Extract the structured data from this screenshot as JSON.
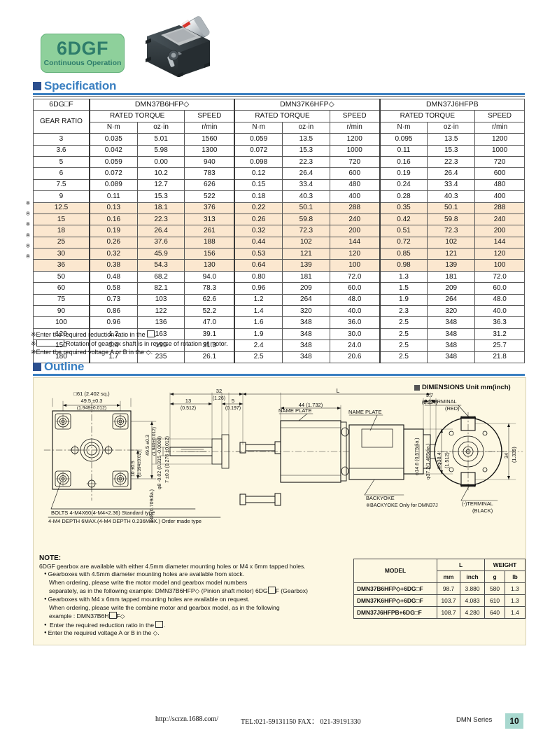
{
  "logo": {
    "model": "6DGF",
    "subtitle": "Continuous Operation"
  },
  "sections": {
    "specification": "Specification",
    "outline": "Outline"
  },
  "spec_table": {
    "corner_label": "6DG□F",
    "gear_ratio_label": "GEAR RATIO",
    "models": [
      "DMN37B6HFP◇",
      "DMN37K6HFP◇",
      "DMN37J6HFPB"
    ],
    "group_headers": [
      "RATED TORQUE",
      "SPEED"
    ],
    "units": [
      "N·m",
      "oz·in",
      "r/min"
    ],
    "rows": [
      {
        "ratio": "3",
        "mark": "",
        "hl": false,
        "v": [
          "0.035",
          "5.01",
          "1560",
          "0.059",
          "13.5",
          "1200",
          "0.095",
          "13.5",
          "1200"
        ]
      },
      {
        "ratio": "3.6",
        "mark": "",
        "hl": false,
        "v": [
          "0.042",
          "5.98",
          "1300",
          "0.072",
          "15.3",
          "1000",
          "0.11",
          "15.3",
          "1000"
        ]
      },
      {
        "ratio": "5",
        "mark": "",
        "hl": false,
        "v": [
          "0.059",
          "0.00",
          "940",
          "0.098",
          "22.3",
          "720",
          "0.16",
          "22.3",
          "720"
        ]
      },
      {
        "ratio": "6",
        "mark": "",
        "hl": false,
        "v": [
          "0.072",
          "10.2",
          "783",
          "0.12",
          "26.4",
          "600",
          "0.19",
          "26.4",
          "600"
        ]
      },
      {
        "ratio": "7.5",
        "mark": "",
        "hl": false,
        "v": [
          "0.089",
          "12.7",
          "626",
          "0.15",
          "33.4",
          "480",
          "0.24",
          "33.4",
          "480"
        ]
      },
      {
        "ratio": "9",
        "mark": "",
        "hl": false,
        "v": [
          "0.11",
          "15.3",
          "522",
          "0.18",
          "40.3",
          "400",
          "0.28",
          "40.3",
          "400"
        ]
      },
      {
        "ratio": "12.5",
        "mark": "※",
        "hl": true,
        "v": [
          "0.13",
          "18.1",
          "376",
          "0.22",
          "50.1",
          "288",
          "0.35",
          "50.1",
          "288"
        ]
      },
      {
        "ratio": "15",
        "mark": "※",
        "hl": true,
        "v": [
          "0.16",
          "22.3",
          "313",
          "0.26",
          "59.8",
          "240",
          "0.42",
          "59.8",
          "240"
        ]
      },
      {
        "ratio": "18",
        "mark": "※",
        "hl": true,
        "v": [
          "0.19",
          "26.4",
          "261",
          "0.32",
          "72.3",
          "200",
          "0.51",
          "72.3",
          "200"
        ]
      },
      {
        "ratio": "25",
        "mark": "※",
        "hl": true,
        "v": [
          "0.26",
          "37.6",
          "188",
          "0.44",
          "102",
          "144",
          "0.72",
          "102",
          "144"
        ]
      },
      {
        "ratio": "30",
        "mark": "※",
        "hl": true,
        "v": [
          "0.32",
          "45.9",
          "156",
          "0.53",
          "121",
          "120",
          "0.85",
          "121",
          "120"
        ]
      },
      {
        "ratio": "36",
        "mark": "※",
        "hl": true,
        "v": [
          "0.38",
          "54.3",
          "130",
          "0.64",
          "139",
          "100",
          "0.98",
          "139",
          "100"
        ]
      },
      {
        "ratio": "50",
        "mark": "",
        "hl": false,
        "v": [
          "0.48",
          "68.2",
          "94.0",
          "0.80",
          "181",
          "72.0",
          "1.3",
          "181",
          "72.0"
        ]
      },
      {
        "ratio": "60",
        "mark": "",
        "hl": false,
        "v": [
          "0.58",
          "82.1",
          "78.3",
          "0.96",
          "209",
          "60.0",
          "1.5",
          "209",
          "60.0"
        ]
      },
      {
        "ratio": "75",
        "mark": "",
        "hl": false,
        "v": [
          "0.73",
          "103",
          "62.6",
          "1.2",
          "264",
          "48.0",
          "1.9",
          "264",
          "48.0"
        ]
      },
      {
        "ratio": "90",
        "mark": "",
        "hl": false,
        "v": [
          "0.86",
          "122",
          "52.2",
          "1.4",
          "320",
          "40.0",
          "2.3",
          "320",
          "40.0"
        ]
      },
      {
        "ratio": "100",
        "mark": "",
        "hl": false,
        "v": [
          "0.96",
          "136",
          "47.0",
          "1.6",
          "348",
          "36.0",
          "2.5",
          "348",
          "36.3"
        ]
      },
      {
        "ratio": "120",
        "mark": "",
        "hl": false,
        "v": [
          "1.2",
          "163",
          "39.1",
          "1.9",
          "348",
          "30.0",
          "2.5",
          "348",
          "31.2"
        ]
      },
      {
        "ratio": "150",
        "mark": "",
        "hl": false,
        "v": [
          "1.4",
          "199",
          "31.3",
          "2.4",
          "348",
          "24.0",
          "2.5",
          "348",
          "25.7"
        ]
      },
      {
        "ratio": "180",
        "mark": "",
        "hl": false,
        "v": [
          "1.7",
          "235",
          "26.1",
          "2.5",
          "348",
          "20.6",
          "2.5",
          "348",
          "21.8"
        ]
      }
    ]
  },
  "spec_notes": {
    "n1_pre": "※Enter the required reduction ratio in the ",
    "n1_post": ".",
    "n2_pre": "※",
    "n2_post": " Rotation of gearbox shaft is in reverse of rotation of motor.",
    "n3": "※Enter the required voltage A or B in the ◇."
  },
  "outline": {
    "dimensions_header": "DIMENSIONS Unit  mm(inch)",
    "labels": {
      "sq61": "□61 (2.402 sq.)",
      "d49_5_top": "49.5 ±0.3",
      "d49_5_top_in": "(1.949±0.012)",
      "d49_5_right": "49.5 ±0.3",
      "d49_5_right_in": "(1.949±0.012)",
      "d10": "10 ±0.5",
      "d10_in": "(0.394±0.02)",
      "bolts1": "BOLTS 4-M4X60(4-M4×2.36) Standard type",
      "bolts2": "4-M4 DEPTH 6MAX.(4-M4 DEPTH 0.236MAX.) Order made type",
      "shaft_dia": "φ8 -0.02 (0.315 -0.0008)",
      "d7": "7 ±0.3 (0.276 ±0.012)",
      "d18": "φ18 (0.709dia.)",
      "d32": "32",
      "d32_in": "(1.26)",
      "d13": "13",
      "d13_in": "(0.512)",
      "d5": "5",
      "d5_in": "(0.197)",
      "d44": "44 (1.732)",
      "dL": "L",
      "d5_7": "5.7",
      "d5_7_in": "(0.224)",
      "nameplate1": "NAME PLATE",
      "nameplate2": "NAME PLATE",
      "backyoke": "BACKYOKE",
      "backyoke_note": "※BACKYOKE Only for DMN37J",
      "d14_6": "φ14.6 (0.575dia.)",
      "d37_2": "φ37.2(1.465dia.)",
      "d38_4": "※φ38.4",
      "d38_4_in": "(1.512)",
      "term_plus": "(+)TERMINAL",
      "term_plus_color": "(RED)",
      "term_minus": "(-)TERMINAL",
      "term_minus_color": "(BLACK)",
      "d34": "34",
      "d34_in": "(1.339)"
    }
  },
  "note": {
    "title": "NOTE:",
    "line1": "6DGF gearbox are available with either 4.5mm diameter mounting holes or M4 x 6mm tapped holes.",
    "b1": "Gearboxes with 4.5mm diameter mounting holes are available from stock.",
    "b1a": "When ordering, please write the motor model and gearbox model numbers",
    "b1b_pre": "separately, as in the following example: DMN37B6HFP◇ (Pinion shaft motor)  6DG",
    "b1b_post": "F (Gearbox)",
    "b2": "Gearboxes with M4 x 6mm tapped mounting holes are available on request.",
    "b2a": "When ordering, please write the combine motor and gearbox model, as in the following",
    "b2b_pre": "example : DMN37B6H",
    "b2b_post": "F◇",
    "b3_pre": "Enter the required reduction ratio in the ",
    "b3_post": ".",
    "b4": "Enter the required voltage A or B in the ◇."
  },
  "weight_table": {
    "headers": {
      "model": "MODEL",
      "l": "L",
      "weight": "WEIGHT",
      "mm": "mm",
      "inch": "inch",
      "g": "g",
      "lb": "lb"
    },
    "rows": [
      {
        "model": "DMN37B6HFP◇+6DG□F",
        "mm": "98.7",
        "inch": "3.880",
        "g": "580",
        "lb": "1.3"
      },
      {
        "model": "DMN37K6HFP◇+6DG□F",
        "mm": "103.7",
        "inch": "4.083",
        "g": "610",
        "lb": "1.3"
      },
      {
        "model": "DMN37J6HFPB+6DG□F",
        "mm": "108.7",
        "inch": "4.280",
        "g": "640",
        "lb": "1.4"
      }
    ]
  },
  "footer": {
    "url": "http://scrzn.1688.com/",
    "tel": "TEL:021-59131150  FAX： 021-39191330",
    "series": "DMN Series",
    "page": "10"
  },
  "colors": {
    "accent_blue": "#3a7fc1",
    "badge_green": "#8ed09b",
    "badge_text": "#2e7d6b",
    "panel_cream": "#fdf8e3",
    "row_highlight": "#fbe7cf",
    "page_tab": "#a8d8cf"
  }
}
